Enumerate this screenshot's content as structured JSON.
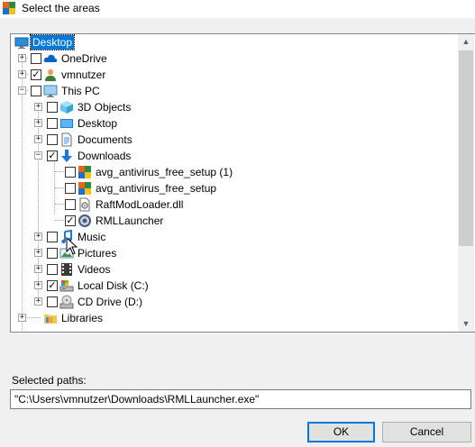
{
  "window": {
    "title": "Select the areas"
  },
  "tree": {
    "items": [
      {
        "label": "Desktop",
        "icon": "desktop-icon",
        "selected": true
      },
      {
        "label": "OneDrive",
        "icon": "cloud-icon",
        "checked": false
      },
      {
        "label": "vmnutzer",
        "icon": "user-icon",
        "checked": true
      },
      {
        "label": "This PC",
        "icon": "computer-icon",
        "checked": false
      },
      {
        "label": "3D Objects",
        "icon": "3d-objects-icon",
        "checked": false
      },
      {
        "label": "Desktop",
        "icon": "desktop-folder-icon",
        "checked": false
      },
      {
        "label": "Documents",
        "icon": "documents-icon",
        "checked": false
      },
      {
        "label": "Downloads",
        "icon": "downloads-icon",
        "checked": true
      },
      {
        "label": "avg_antivirus_free_setup (1)",
        "icon": "avg-installer-icon",
        "checked": false
      },
      {
        "label": "avg_antivirus_free_setup",
        "icon": "avg-installer-icon",
        "checked": false
      },
      {
        "label": "RaftModLoader.dll",
        "icon": "dll-file-icon",
        "checked": false
      },
      {
        "label": "RMLLauncher",
        "icon": "launcher-icon",
        "checked": true
      },
      {
        "label": "Music",
        "icon": "music-icon",
        "checked": false
      },
      {
        "label": "Pictures",
        "icon": "pictures-icon",
        "checked": false
      },
      {
        "label": "Videos",
        "icon": "videos-icon",
        "checked": false
      },
      {
        "label": "Local Disk (C:)",
        "icon": "local-disk-icon",
        "checked": true
      },
      {
        "label": "CD Drive (D:)",
        "icon": "cd-drive-icon",
        "checked": false
      },
      {
        "label": "Libraries",
        "icon": "libraries-icon"
      }
    ]
  },
  "selected_paths": {
    "label": "Selected paths:",
    "value": "\"C:\\Users\\vmnutzer\\Downloads\\RMLLauncher.exe\""
  },
  "buttons": {
    "ok": "OK",
    "cancel": "Cancel"
  },
  "colors": {
    "selection": "#0078d7",
    "dialog_bg": "#f0f0f0",
    "ok_border": "#0078d7"
  }
}
